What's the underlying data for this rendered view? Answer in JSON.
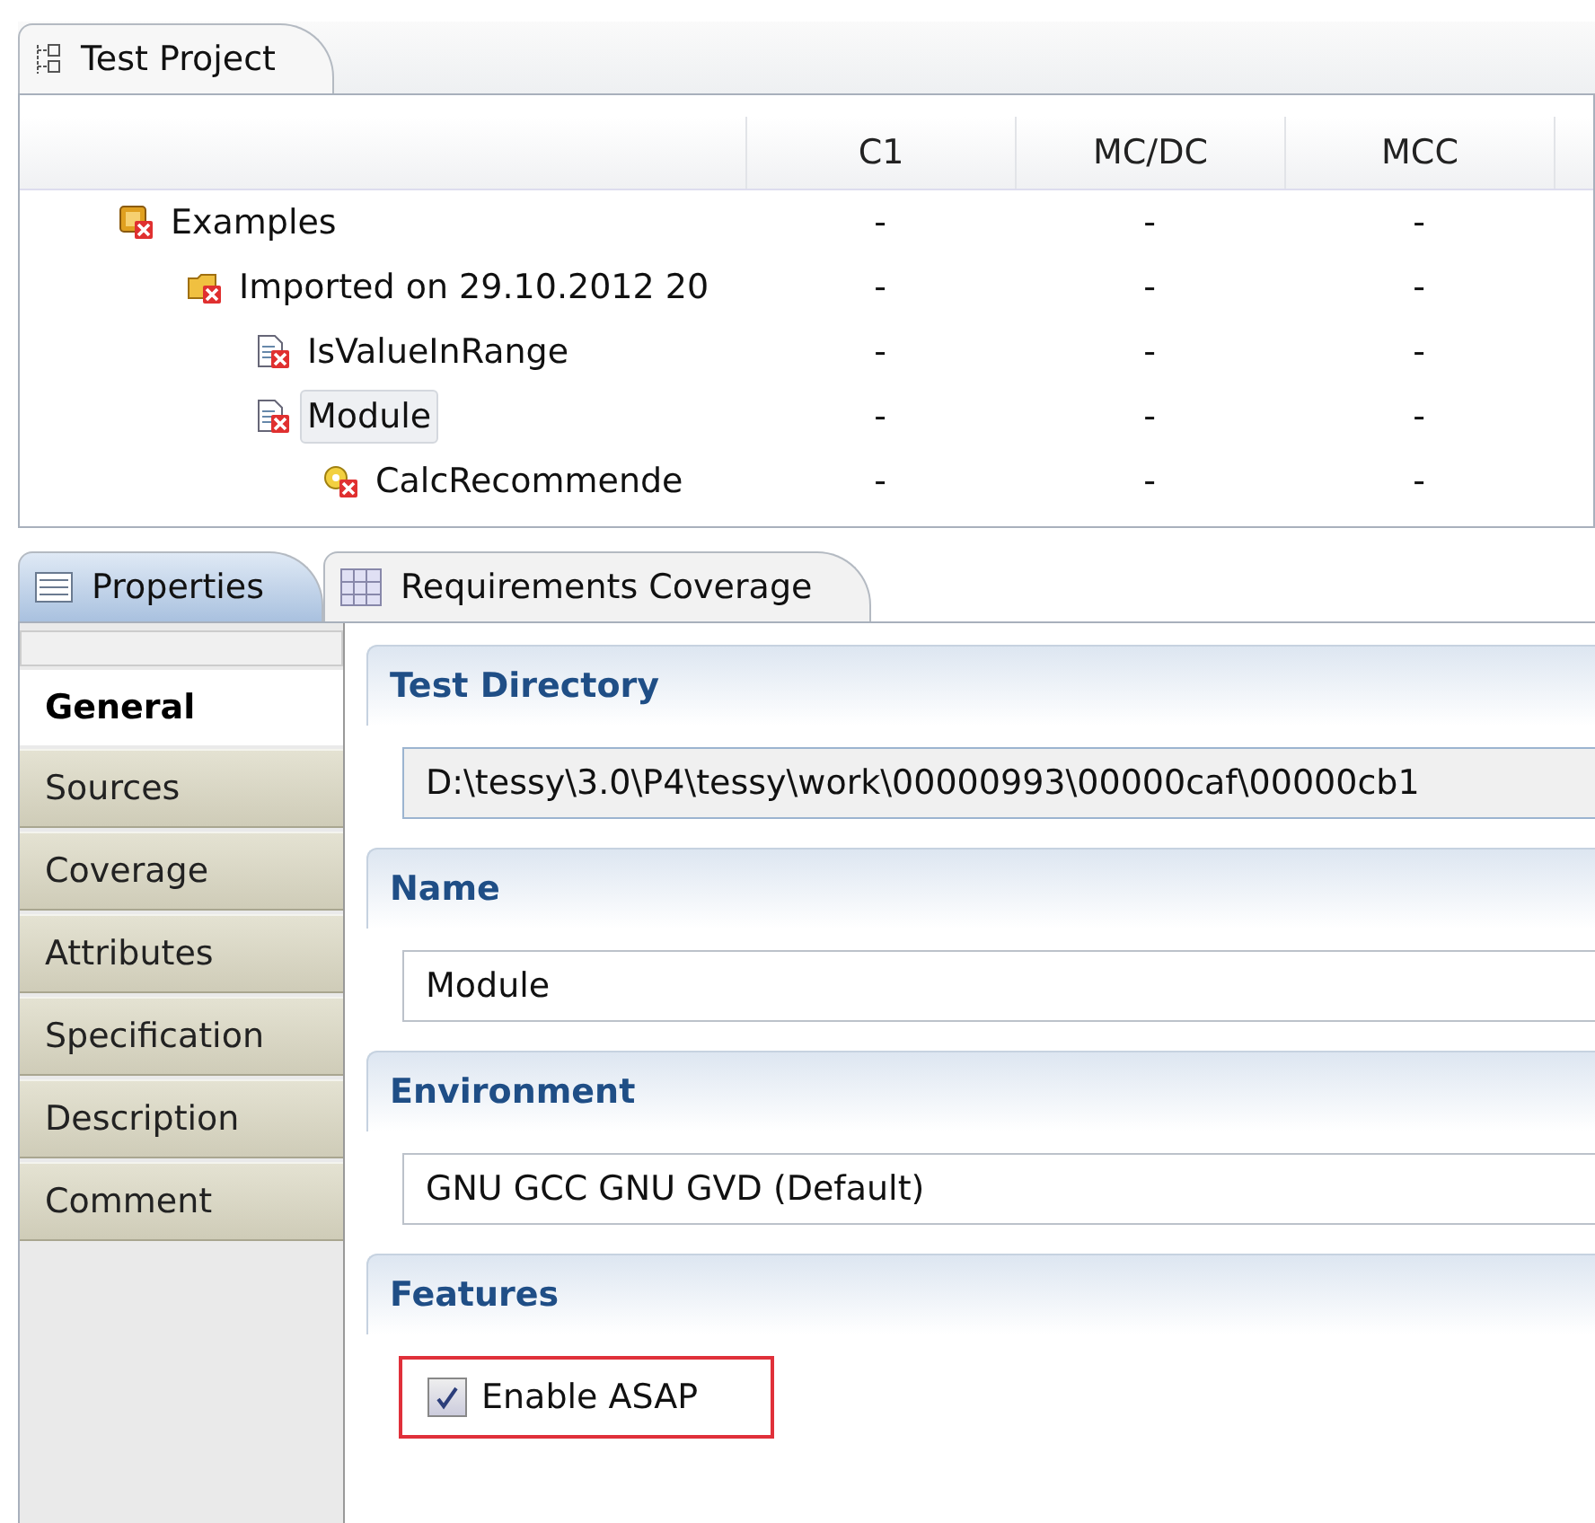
{
  "top_view": {
    "tab": {
      "label": "Test Project",
      "selected": true
    },
    "columns": [
      "C1",
      "MC/DC",
      "MCC"
    ],
    "tree": [
      {
        "label": "Examples",
        "kind": "project",
        "selected": false,
        "values": [
          "-",
          "-",
          "-"
        ],
        "children": [
          {
            "label": "Imported on 29.10.2012 20",
            "kind": "folder",
            "selected": false,
            "values": [
              "-",
              "-",
              "-"
            ],
            "children": [
              {
                "label": "IsValueInRange",
                "kind": "module",
                "selected": false,
                "values": [
                  "-",
                  "-",
                  "-"
                ]
              },
              {
                "label": "Module",
                "kind": "module",
                "selected": true,
                "values": [
                  "-",
                  "-",
                  "-"
                ],
                "children": [
                  {
                    "label": "CalcRecommende",
                    "kind": "function",
                    "selected": false,
                    "values": [
                      "-",
                      "-",
                      "-"
                    ]
                  }
                ]
              }
            ]
          }
        ]
      }
    ]
  },
  "bottom_view": {
    "tabs": [
      {
        "label": "Properties",
        "kind": "list",
        "selected": true
      },
      {
        "label": "Requirements Coverage",
        "kind": "grid",
        "selected": false
      }
    ],
    "side_tabs": [
      {
        "label": "General",
        "selected": true
      },
      {
        "label": "Sources",
        "selected": false
      },
      {
        "label": "Coverage",
        "selected": false
      },
      {
        "label": "Attributes",
        "selected": false
      },
      {
        "label": "Specification",
        "selected": false
      },
      {
        "label": "Description",
        "selected": false
      },
      {
        "label": "Comment",
        "selected": false
      }
    ],
    "sections": [
      {
        "title": "Test Directory",
        "kind": "field",
        "value": "D:\\tessy\\3.0\\P4\\tessy\\work\\00000993\\00000caf\\00000cb1",
        "readonly": true
      },
      {
        "title": "Name",
        "kind": "field",
        "value": "Module",
        "readonly": false
      },
      {
        "title": "Environment",
        "kind": "field",
        "value": "GNU GCC GNU GVD (Default)",
        "readonly": false
      },
      {
        "title": "Features",
        "kind": "checkbox",
        "label": "Enable ASAP",
        "checked": true,
        "highlighted": true
      }
    ]
  }
}
